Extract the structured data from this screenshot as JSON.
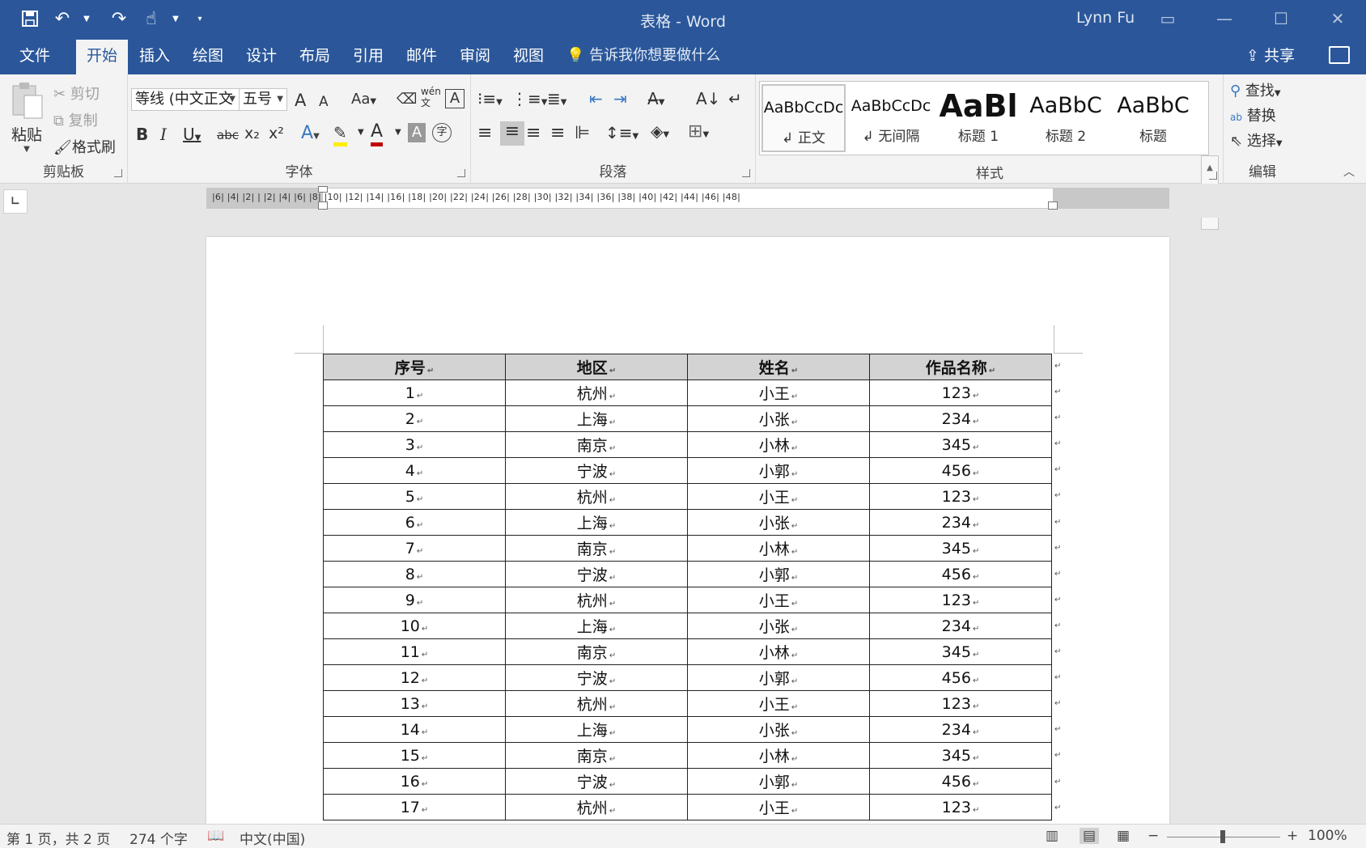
{
  "window": {
    "title": "表格 - Word",
    "user": "Lynn Fu"
  },
  "menu_tabs": [
    "文件",
    "开始",
    "插入",
    "绘图",
    "设计",
    "布局",
    "引用",
    "邮件",
    "审阅",
    "视图"
  ],
  "tell_me": "告诉我你想要做什么",
  "share_label": "共享",
  "ribbon": {
    "clipboard": {
      "paste": "粘贴",
      "cut": "剪切",
      "copy": "复制",
      "format_painter": "格式刷",
      "label": "剪贴板"
    },
    "font": {
      "font_name": "等线 (中文正文",
      "font_size": "五号",
      "label": "字体",
      "bold": "B",
      "italic": "I",
      "underline": "U",
      "strike": "abc",
      "subscript": "x₂",
      "superscript": "x²",
      "grow": "A",
      "shrink": "A",
      "change_case": "Aa",
      "phonetic": "wén",
      "border_char": "A",
      "circle_char": "字"
    },
    "paragraph": {
      "label": "段落"
    },
    "styles": {
      "label": "样式",
      "items": [
        {
          "sample": "AaBbCcDc",
          "name": "↲ 正文"
        },
        {
          "sample": "AaBbCcDc",
          "name": "↲ 无间隔"
        },
        {
          "sample": "AaBl",
          "name": "标题 1"
        },
        {
          "sample": "AaBbC",
          "name": "标题 2"
        },
        {
          "sample": "AaBbC",
          "name": "标题"
        }
      ]
    },
    "editing": {
      "label": "编辑",
      "find": "查找",
      "replace": "替换",
      "select": "选择"
    }
  },
  "ruler": {
    "numbers": "|6|  |4|  |2|  |  |2|  |4|  |6|  |8|  |10|  |12|  |14|  |16|  |18|  |20|  |22|  |24|  |26|  |28|  |30|  |32|  |34|  |36|  |38|  |40|  |42|  |44|  |46|  |48|"
  },
  "table": {
    "headers": [
      "序号",
      "地区",
      "姓名",
      "作品名称"
    ],
    "rows": [
      [
        "1",
        "杭州",
        "小王",
        "123"
      ],
      [
        "2",
        "上海",
        "小张",
        "234"
      ],
      [
        "3",
        "南京",
        "小林",
        "345"
      ],
      [
        "4",
        "宁波",
        "小郭",
        "456"
      ],
      [
        "5",
        "杭州",
        "小王",
        "123"
      ],
      [
        "6",
        "上海",
        "小张",
        "234"
      ],
      [
        "7",
        "南京",
        "小林",
        "345"
      ],
      [
        "8",
        "宁波",
        "小郭",
        "456"
      ],
      [
        "9",
        "杭州",
        "小王",
        "123"
      ],
      [
        "10",
        "上海",
        "小张",
        "234"
      ],
      [
        "11",
        "南京",
        "小林",
        "345"
      ],
      [
        "12",
        "宁波",
        "小郭",
        "456"
      ],
      [
        "13",
        "杭州",
        "小王",
        "123"
      ],
      [
        "14",
        "上海",
        "小张",
        "234"
      ],
      [
        "15",
        "南京",
        "小林",
        "345"
      ],
      [
        "16",
        "宁波",
        "小郭",
        "456"
      ],
      [
        "17",
        "杭州",
        "小王",
        "123"
      ]
    ]
  },
  "status": {
    "page": "第 1 页，共 2 页",
    "words": "274 个字",
    "language": "中文(中国)",
    "zoom": "100%"
  },
  "colors": {
    "accent": "#2b579a",
    "header_fill": "#d3d3d3"
  }
}
